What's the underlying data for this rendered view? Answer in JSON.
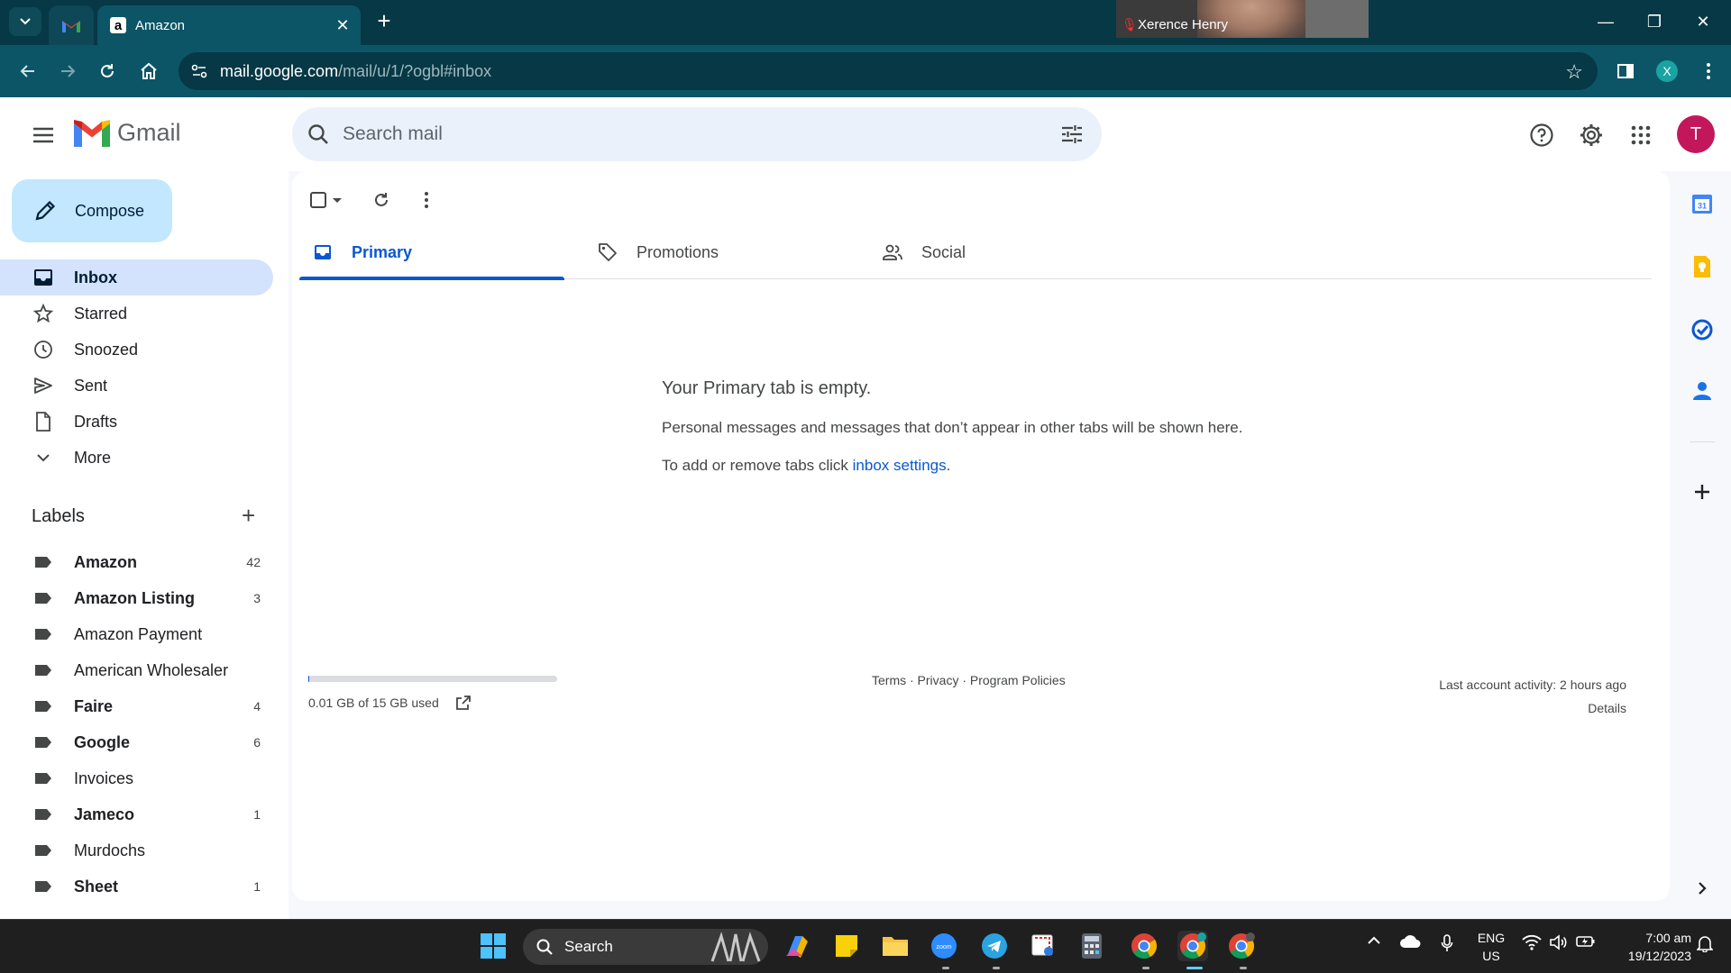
{
  "browser": {
    "tabs": [
      {
        "title": ""
      },
      {
        "title": "Amazon",
        "favicon": "a"
      }
    ],
    "url_host": "mail.google.com",
    "url_path": "/mail/u/1/?ogbl#inbox",
    "profile_initial": "X",
    "video_call": {
      "name": "Xerence Henry"
    }
  },
  "gmail": {
    "logo_text": "Gmail",
    "search_placeholder": "Search mail",
    "avatar_initial": "T",
    "compose_label": "Compose",
    "nav": [
      {
        "label": "Inbox",
        "icon": "inbox-icon",
        "active": true
      },
      {
        "label": "Starred",
        "icon": "star-icon"
      },
      {
        "label": "Snoozed",
        "icon": "clock-icon"
      },
      {
        "label": "Sent",
        "icon": "send-icon"
      },
      {
        "label": "Drafts",
        "icon": "draft-icon"
      },
      {
        "label": "More",
        "icon": "chevron-down-icon"
      }
    ],
    "labels_title": "Labels",
    "labels": [
      {
        "name": "Amazon",
        "count": "42",
        "bold": true
      },
      {
        "name": "Amazon Listing",
        "count": "3",
        "bold": true
      },
      {
        "name": "Amazon Payment",
        "count": "",
        "bold": false
      },
      {
        "name": "American Wholesaler",
        "count": "",
        "bold": false
      },
      {
        "name": "Faire",
        "count": "4",
        "bold": true
      },
      {
        "name": "Google",
        "count": "6",
        "bold": true
      },
      {
        "name": "Invoices",
        "count": "",
        "bold": false
      },
      {
        "name": "Jameco",
        "count": "1",
        "bold": true
      },
      {
        "name": "Murdochs",
        "count": "",
        "bold": false
      },
      {
        "name": "Sheet",
        "count": "1",
        "bold": true
      }
    ],
    "category_tabs": [
      {
        "label": "Primary",
        "icon": "inbox-tab-icon",
        "active": true
      },
      {
        "label": "Promotions",
        "icon": "tag-icon"
      },
      {
        "label": "Social",
        "icon": "people-icon"
      }
    ],
    "empty_state": {
      "title": "Your Primary tab is empty.",
      "line1": "Personal messages and messages that don’t appear in other tabs will be shown here.",
      "line2_prefix": "To add or remove tabs click ",
      "line2_link": "inbox settings",
      "line2_suffix": "."
    },
    "footer": {
      "storage": "0.01 GB of 15 GB used",
      "storage_fraction": 0.001,
      "policies": "Terms · Privacy · Program Policies",
      "activity": "Last account activity: 2 hours ago",
      "details": "Details"
    },
    "side_calendar_day": "31"
  },
  "taskbar": {
    "search_label": "Search",
    "lang_line1": "ENG",
    "lang_line2": "US",
    "time": "7:00 am",
    "date": "19/12/2023"
  }
}
